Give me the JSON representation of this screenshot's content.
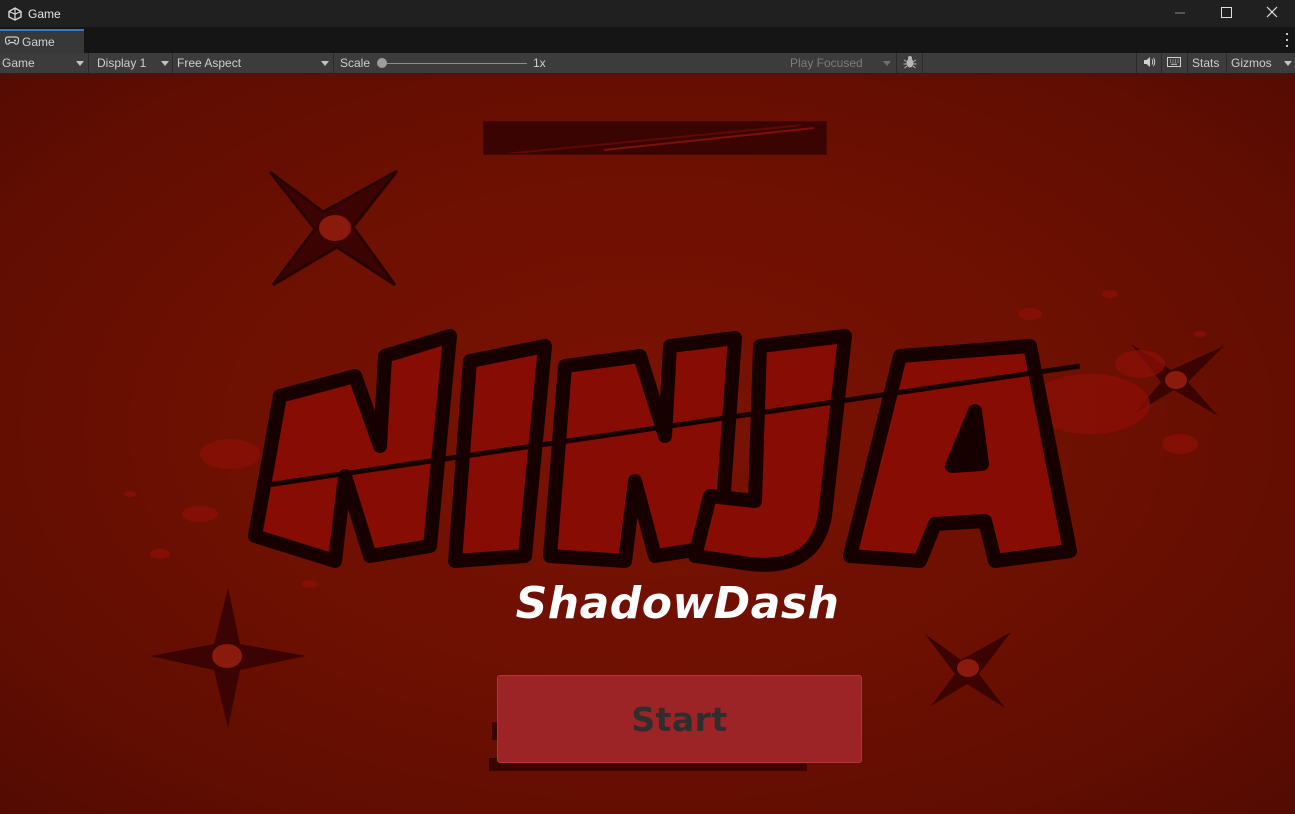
{
  "window": {
    "title": "Game",
    "icon": "unity-icon"
  },
  "tab": {
    "label": "Game",
    "icon": "gamepad-icon"
  },
  "toolbar": {
    "mode_label": "Game",
    "display_label": "Display 1",
    "aspect_label": "Free Aspect",
    "scale_label": "Scale",
    "scale_value": "1x",
    "scale_level": 0.0,
    "play_mode_label": "Play Focused",
    "stats_label": "Stats",
    "gizmos_label": "Gizmos"
  },
  "game": {
    "subtitle": "ShadowDash",
    "start_button_label": "Start"
  },
  "colors": {
    "background": "#6e1002",
    "logo_fill": "#8a0c04",
    "logo_outline": "#1a0000",
    "button": "#9c2427",
    "button_text": "#2e2e2e",
    "accent_tab": "#3a79bb"
  }
}
